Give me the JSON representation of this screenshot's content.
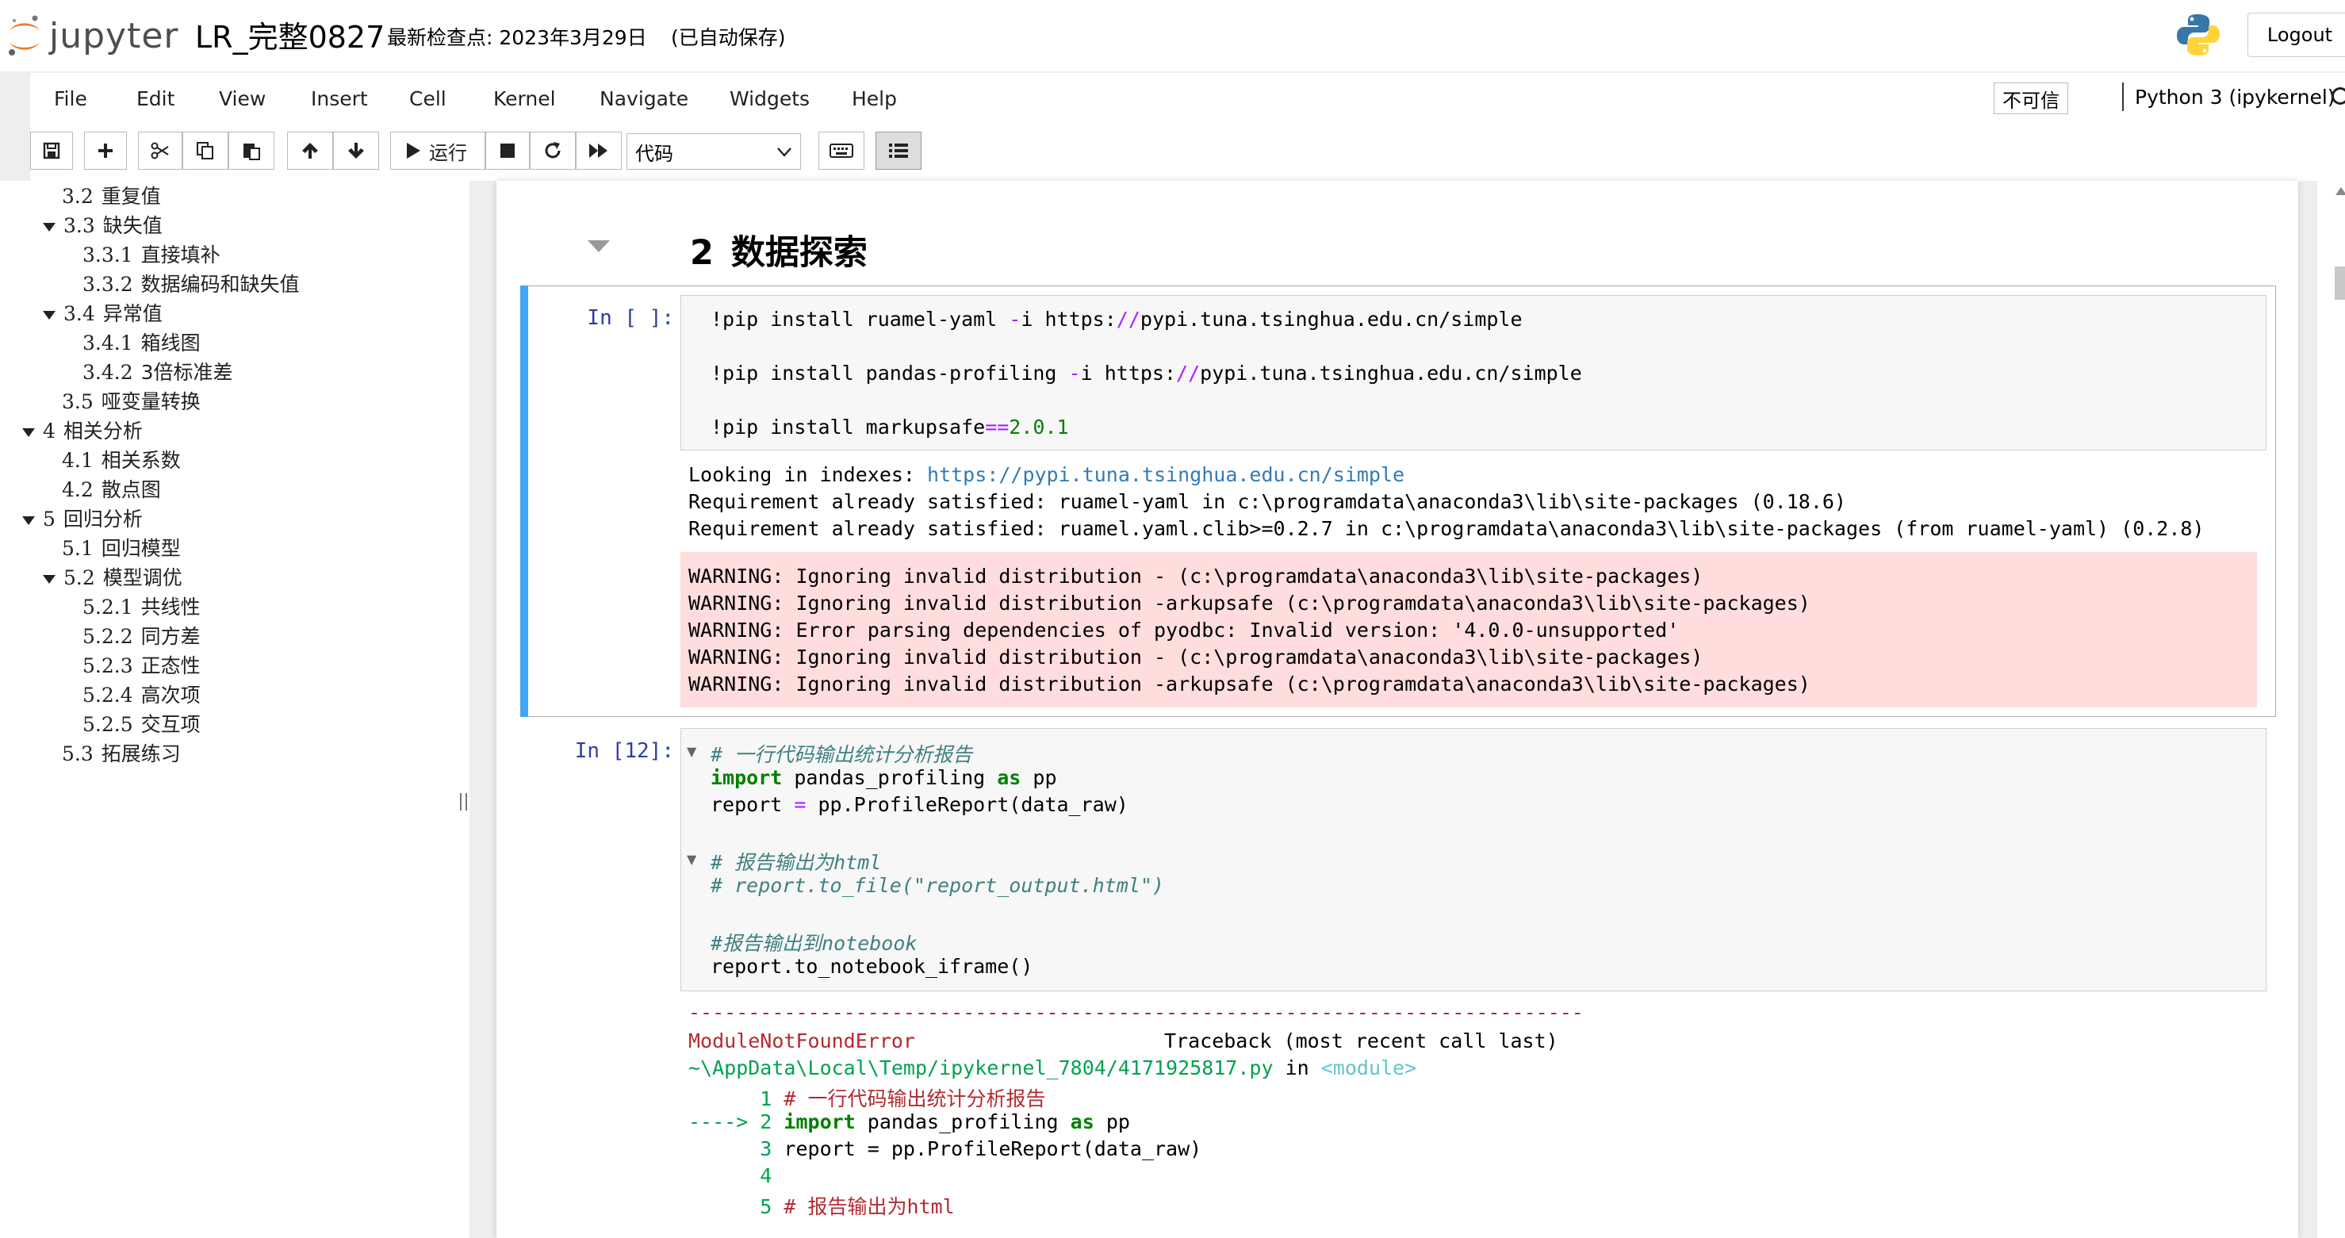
{
  "header": {
    "logo_text": "jupyter",
    "notebook_name": "LR_完整0827",
    "checkpoint": "最新检查点: 2023年3月29日",
    "autosave": "(已自动保存)",
    "logout": "Logout"
  },
  "menubar": {
    "items": [
      "File",
      "Edit",
      "View",
      "Insert",
      "Cell",
      "Kernel",
      "Navigate",
      "Widgets",
      "Help"
    ],
    "trusted": "不可信",
    "kernel": "Python 3 (ipykernel)"
  },
  "toolbar": {
    "run_label": "运行",
    "cell_type": "代码",
    "icons": [
      "save-icon",
      "plus-icon",
      "scissors-icon",
      "copy-icon",
      "paste-icon",
      "arrow-up-icon",
      "arrow-down-icon",
      "run-icon",
      "stop-icon",
      "restart-icon",
      "fast-forward-icon",
      "keyboard-icon",
      "list-icon"
    ]
  },
  "toc": {
    "items": [
      {
        "num": "3.2",
        "label": "重复值"
      },
      {
        "num": "3.3",
        "label": "缺失值"
      },
      {
        "num": "3.3.1",
        "label": "直接填补"
      },
      {
        "num": "3.3.2",
        "label": "数据编码和缺失值"
      },
      {
        "num": "3.4",
        "label": "异常值"
      },
      {
        "num": "3.4.1",
        "label": "箱线图"
      },
      {
        "num": "3.4.2",
        "label": "3倍标准差"
      },
      {
        "num": "3.5",
        "label": "哑变量转换"
      },
      {
        "num": "4",
        "label": "相关分析"
      },
      {
        "num": "4.1",
        "label": "相关系数"
      },
      {
        "num": "4.2",
        "label": "散点图"
      },
      {
        "num": "5",
        "label": "回归分析"
      },
      {
        "num": "5.1",
        "label": "回归模型"
      },
      {
        "num": "5.2",
        "label": "模型调优"
      },
      {
        "num": "5.2.1",
        "label": "共线性"
      },
      {
        "num": "5.2.2",
        "label": "同方差"
      },
      {
        "num": "5.2.3",
        "label": "正态性"
      },
      {
        "num": "5.2.4",
        "label": "高次项"
      },
      {
        "num": "5.2.5",
        "label": "交互项"
      },
      {
        "num": "5.3",
        "label": "拓展练习"
      }
    ]
  },
  "notebook": {
    "heading_num": "2",
    "heading_text": "数据探索",
    "cell1": {
      "prompt": "In [ ]:",
      "code": [
        {
          "a": "!pip install ruamel-yaml ",
          "op": "-",
          "b": "i https:",
          "op2": "//",
          "c": "pypi.tuna.tsinghua.edu.cn/simple"
        },
        {
          "a": "!pip install pandas-profiling ",
          "op": "-",
          "b": "i https:",
          "op2": "//",
          "c": "pypi.tuna.tsinghua.edu.cn/simple"
        },
        {
          "a": "!pip install markupsafe",
          "op": "==",
          "b": "2.0.1"
        }
      ],
      "stdout": {
        "looking_prefix": "Looking in indexes: ",
        "looking_url": "https://pypi.tuna.tsinghua.edu.cn/simple",
        "lines": [
          "Requirement already satisfied: ruamel-yaml in c:\\programdata\\anaconda3\\lib\\site-packages (0.18.6)",
          "Requirement already satisfied: ruamel.yaml.clib>=0.2.7 in c:\\programdata\\anaconda3\\lib\\site-packages (from ruamel-yaml) (0.2.8)"
        ]
      },
      "stderr": [
        "WARNING: Ignoring invalid distribution - (c:\\programdata\\anaconda3\\lib\\site-packages)",
        "WARNING: Ignoring invalid distribution -arkupsafe (c:\\programdata\\anaconda3\\lib\\site-packages)",
        "WARNING: Error parsing dependencies of pyodbc: Invalid version: '4.0.0-unsupported'",
        "WARNING: Ignoring invalid distribution - (c:\\programdata\\anaconda3\\lib\\site-packages)",
        "WARNING: Ignoring invalid distribution -arkupsafe (c:\\programdata\\anaconda3\\lib\\site-packages)"
      ]
    },
    "cell2": {
      "prompt": "In [12]:",
      "comment1": "# 一行代码输出统计分析报告",
      "import_kw": "import",
      "import_mod": " pandas_profiling ",
      "as_kw": "as",
      "import_alias": " pp",
      "report_a": "report ",
      "report_op": "=",
      "report_b": " pp.ProfileReport(data_raw)",
      "comment2": "# 报告输出为html",
      "comment3": "# report.to_file(\"report_output.html\")",
      "comment4": "#报告输出到notebook",
      "last_line": "report.to_notebook_iframe()",
      "error": {
        "dashes": "---------------------------------------------------------------------------",
        "name": "ModuleNotFoundError",
        "traceback_label": "Traceback (most recent call last)",
        "path": "~\\AppData\\Local\\Temp/ipykernel_7804/4171925817.py",
        "in_word": " in ",
        "module": "<module>",
        "tb_lines": [
          {
            "n": "      1",
            "text": " # 一行代码输出统计分析报告"
          },
          {
            "n": "----> 2",
            "kw": " import",
            "text": " pandas_profiling ",
            "kw2": "as",
            "tail": " pp"
          },
          {
            "n": "      3",
            "text": " report = pp.ProfileReport(data_raw)"
          },
          {
            "n": "      4",
            "text": ""
          },
          {
            "n": "      5",
            "text": " # 报告输出为html"
          }
        ]
      }
    }
  }
}
